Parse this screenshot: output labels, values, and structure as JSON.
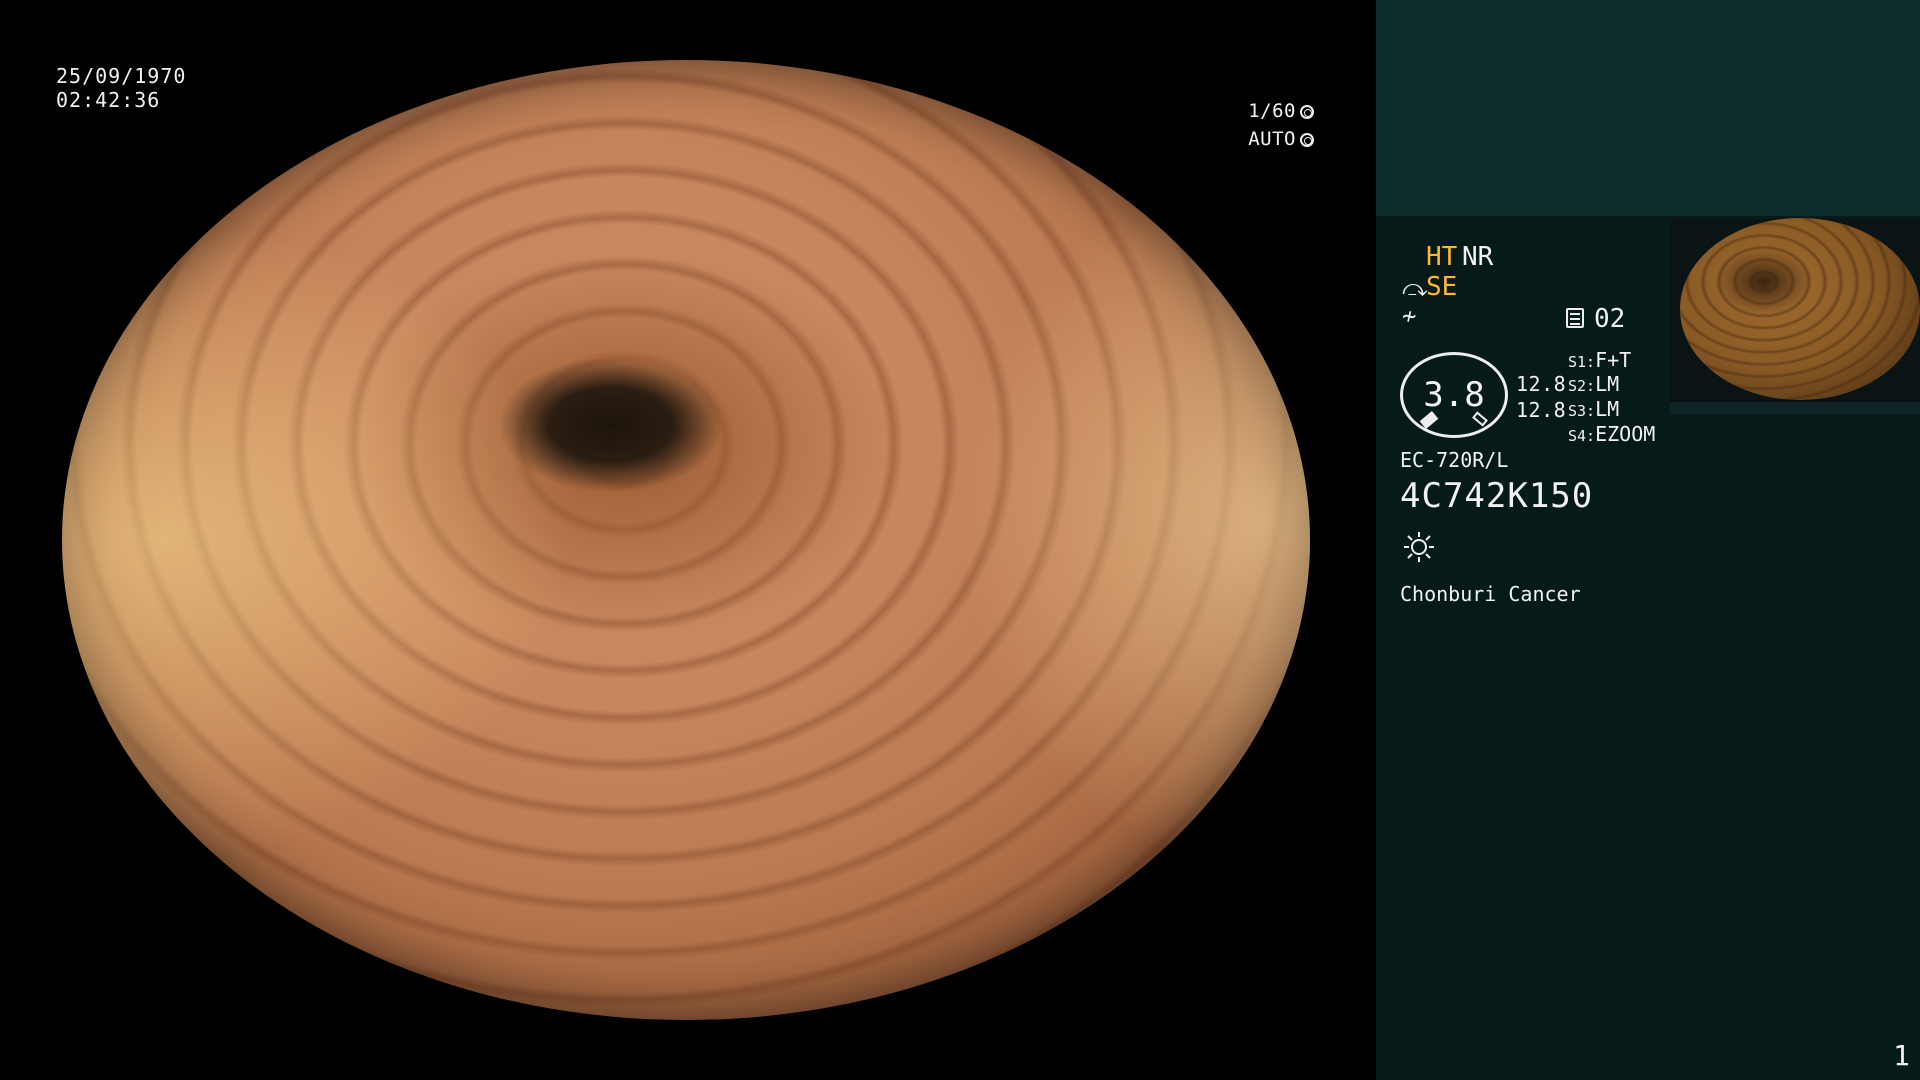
{
  "overlay": {
    "date": "25/09/1970",
    "time": "02:42:36",
    "shutter_speed": "1/60",
    "exposure_mode": "AUTO"
  },
  "panel": {
    "mode_ht": "HT",
    "mode_nr": "NR",
    "mode_se": "SE",
    "counter": "02",
    "gauge_value": "3.8",
    "gauge_num1": "12.8",
    "gauge_num2": "12.8",
    "switches": [
      {
        "key": "S1:",
        "value": "F+T"
      },
      {
        "key": "S2:",
        "value": "LM"
      },
      {
        "key": "S3:",
        "value": "LM"
      },
      {
        "key": "S4:",
        "value": "EZOOM"
      }
    ],
    "scope_model": "EC-720R/L",
    "serial": "4C742K150",
    "hospital": "Chonburi Cancer",
    "page_number": "1"
  },
  "icons": {
    "shutter": "shutter-icon",
    "auto": "auto-iris-icon",
    "se": "structure-enhance-icon",
    "freeze": "freeze-icon",
    "counter": "counter-icon",
    "light": "light-source-icon"
  },
  "colors": {
    "accent": "#ffb833",
    "panel_bg": "#061a1a",
    "panel_top": "#0d2b2b"
  }
}
